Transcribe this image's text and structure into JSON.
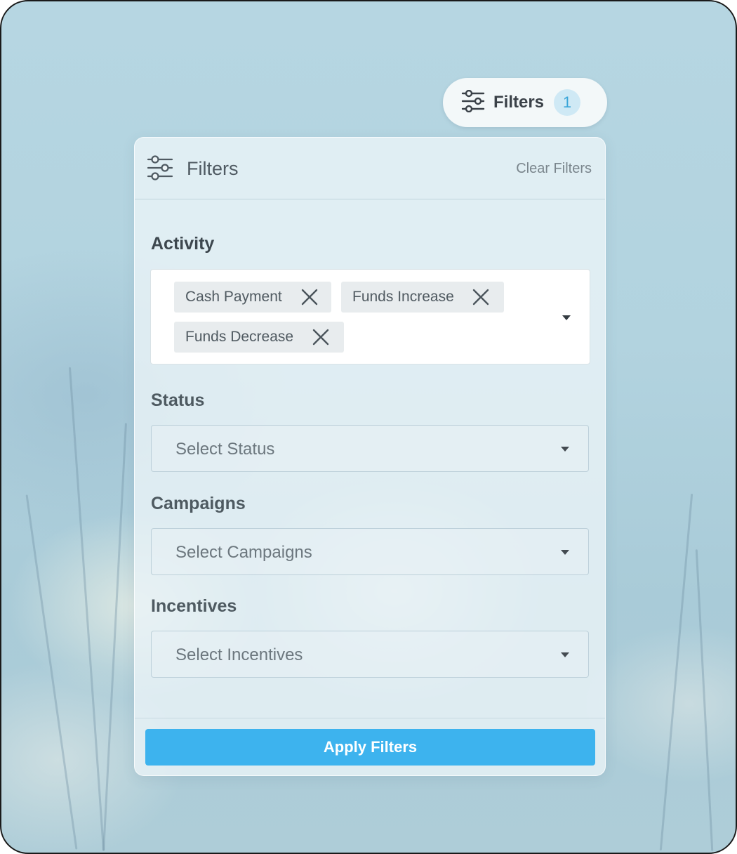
{
  "trigger": {
    "icon": "sliders-icon",
    "label": "Filters",
    "badge_count": "1"
  },
  "panel": {
    "icon": "sliders-icon",
    "title": "Filters",
    "clear_label": "Clear Filters",
    "activity": {
      "label": "Activity",
      "selected": [
        "Cash Payment",
        "Funds Increase",
        "Funds Decrease"
      ]
    },
    "status": {
      "label": "Status",
      "placeholder": "Select Status"
    },
    "campaigns": {
      "label": "Campaigns",
      "placeholder": "Select Campaigns"
    },
    "incentives": {
      "label": "Incentives",
      "placeholder": "Select Incentives"
    },
    "apply_label": "Apply Filters"
  },
  "colors": {
    "accent": "#3db3ee",
    "badge_bg": "#cfe9f5",
    "badge_text": "#3aa5d8"
  }
}
